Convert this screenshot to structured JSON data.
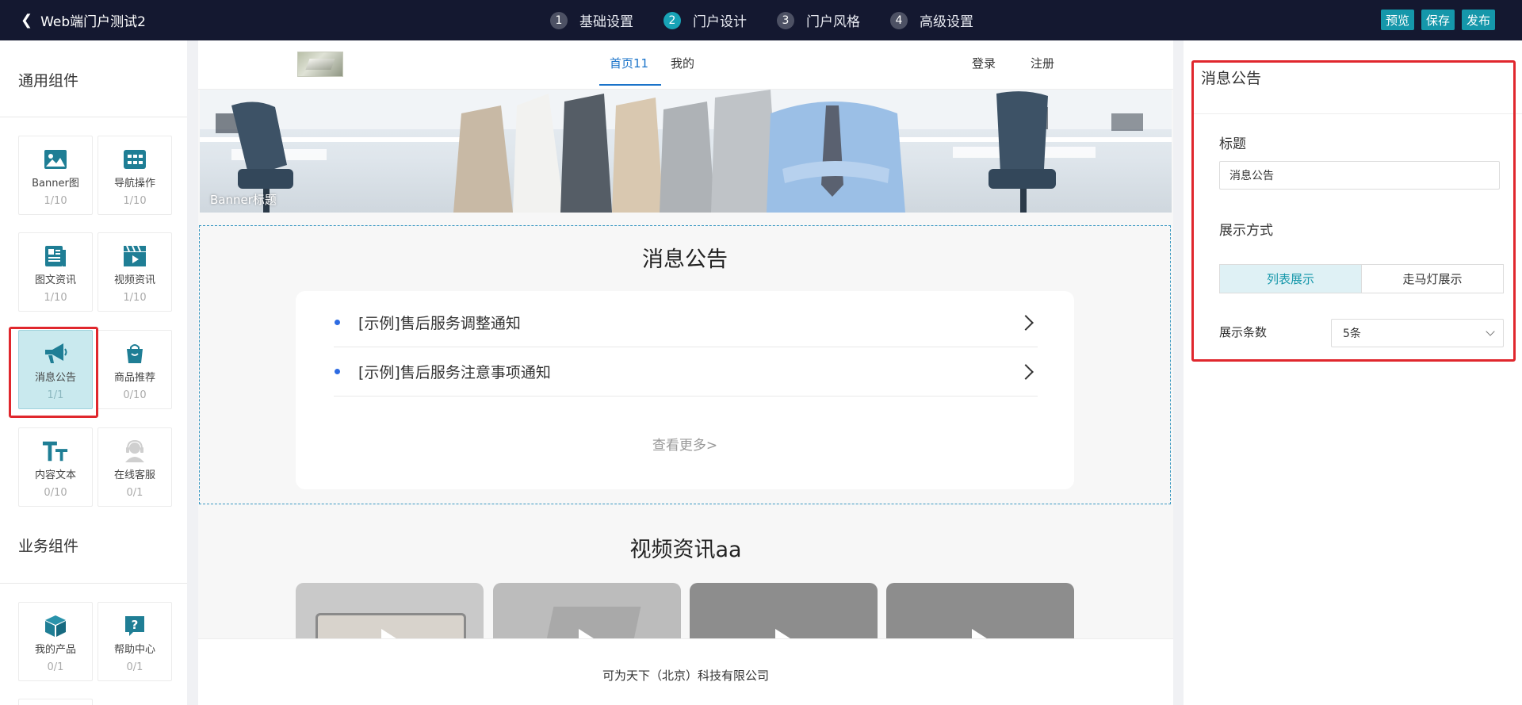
{
  "topbar": {
    "back_title": "Web端门户测试2",
    "steps": [
      {
        "num": "1",
        "label": "基础设置"
      },
      {
        "num": "2",
        "label": "门户设计"
      },
      {
        "num": "3",
        "label": "门户风格"
      },
      {
        "num": "4",
        "label": "高级设置"
      }
    ],
    "active_step": 2,
    "actions": {
      "preview": "预览",
      "save": "保存",
      "publish": "发布"
    }
  },
  "left": {
    "general_title": "通用组件",
    "business_title": "业务组件",
    "general": [
      {
        "label": "Banner图",
        "count": "1/10",
        "icon": "image-icon"
      },
      {
        "label": "导航操作",
        "count": "1/10",
        "icon": "nav-icon"
      },
      {
        "label": "图文资讯",
        "count": "1/10",
        "icon": "article-icon"
      },
      {
        "label": "视频资讯",
        "count": "1/10",
        "icon": "video-icon"
      },
      {
        "label": "消息公告",
        "count": "1/1",
        "icon": "megaphone-icon"
      },
      {
        "label": "商品推荐",
        "count": "0/10",
        "icon": "shopping-bag-icon"
      },
      {
        "label": "内容文本",
        "count": "0/10",
        "icon": "text-icon"
      },
      {
        "label": "在线客服",
        "count": "0/1",
        "icon": "customer-service-icon"
      }
    ],
    "business": [
      {
        "label": "我的产品",
        "count": "0/1",
        "icon": "product-box-icon"
      },
      {
        "label": "帮助中心",
        "count": "0/1",
        "icon": "help-icon"
      }
    ]
  },
  "canvas": {
    "nav": {
      "tab1": "首页11",
      "tab2": "我的",
      "login": "登录",
      "register": "注册"
    },
    "banner_label": "Banner标题",
    "notice": {
      "title": "消息公告",
      "items": [
        "[示例]售后服务调整通知",
        "[示例]售后服务注意事项通知"
      ],
      "more": "查看更多>"
    },
    "video_title": "视频资讯aa",
    "footer": "可为天下（北京）科技有限公司"
  },
  "right": {
    "header": "消息公告",
    "title_label": "标题",
    "title_value": "消息公告",
    "mode_label": "展示方式",
    "mode_options": [
      "列表展示",
      "走马灯展示"
    ],
    "count_label": "展示条数",
    "count_value": "5条"
  },
  "colors": {
    "topbar": "#141830",
    "accent": "#1597aa",
    "highlight": "#e0272d"
  }
}
